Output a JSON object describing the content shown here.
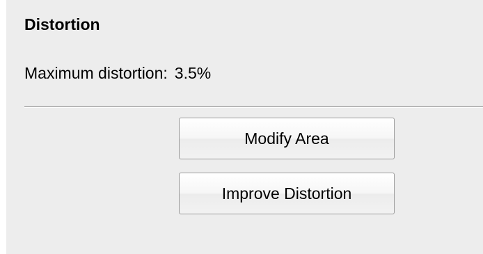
{
  "section": {
    "title": "Distortion"
  },
  "distortion": {
    "label": "Maximum distortion:",
    "value": "3.5%"
  },
  "buttons": {
    "modify_area": "Modify Area",
    "improve_distortion": "Improve Distortion"
  }
}
